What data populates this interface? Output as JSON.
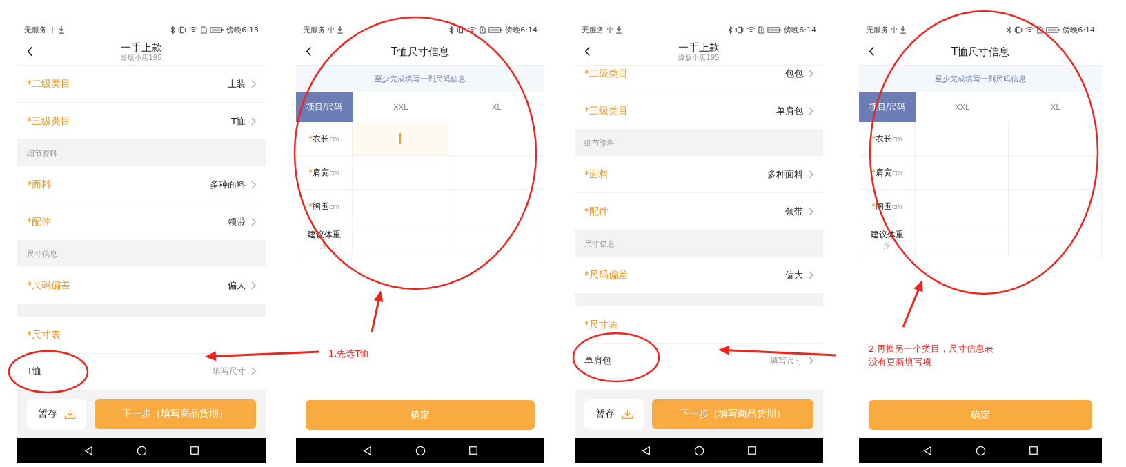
{
  "screens": [
    {
      "kind": "form",
      "scrolled": false,
      "status_bar": {
        "carrier": "无服务",
        "time": "傍晚6:13"
      },
      "header": {
        "title": "一手上款",
        "subtitle": "爆版小店195"
      },
      "items": [
        {
          "kind": "row",
          "label": "*二级类目",
          "value": "上装"
        },
        {
          "kind": "row",
          "label": "*三级类目",
          "value": "T恤"
        },
        {
          "kind": "section",
          "label": "细节资料"
        },
        {
          "kind": "row",
          "label": "*面料",
          "value": "多种面料"
        },
        {
          "kind": "row",
          "label": "*配件",
          "value": "领带"
        },
        {
          "kind": "section",
          "label": "尺寸信息"
        },
        {
          "kind": "row",
          "label": "*尺码偏差",
          "value": "偏大"
        },
        {
          "kind": "gap"
        },
        {
          "kind": "title",
          "label": "*尺寸表"
        },
        {
          "kind": "link",
          "label": "T恤",
          "value": "填写尺寸"
        }
      ],
      "footer": {
        "save": "暂存",
        "next": "下一步（填写商品货期）"
      }
    },
    {
      "kind": "size_table",
      "status_bar": {
        "carrier": "无服务",
        "time": "傍晚6:14"
      },
      "header": {
        "title": "T恤尺寸信息"
      },
      "notice": "至少完成填写一列尺码信息",
      "table": {
        "corner": "项目/尺码",
        "columns": [
          "XXL",
          "XL"
        ],
        "rows": [
          {
            "mark": "*",
            "label": "衣长",
            "unit": "cm",
            "cells": [
              {
                "focused": true
              },
              {
                "focused": false
              }
            ]
          },
          {
            "mark": "*",
            "label": "肩宽",
            "unit": "cm",
            "cells": [
              {
                "focused": false
              },
              {
                "focused": false
              }
            ]
          },
          {
            "mark": "*",
            "label": "胸围",
            "unit": "cm",
            "cells": [
              {
                "focused": false
              },
              {
                "focused": false
              }
            ]
          },
          {
            "label": "建议体重",
            "unit": "斤",
            "cells": [
              {
                "focused": false
              },
              {
                "focused": false
              }
            ]
          }
        ]
      },
      "confirm": "确定"
    },
    {
      "kind": "form",
      "scrolled": true,
      "status_bar": {
        "carrier": "无服务",
        "time": "傍晚6:14"
      },
      "header": {
        "title": "一手上款",
        "subtitle": "爆版小店195"
      },
      "items": [
        {
          "kind": "row",
          "label": "*二级类目",
          "value": "包包"
        },
        {
          "kind": "row",
          "label": "*三级类目",
          "value": "单肩包"
        },
        {
          "kind": "section",
          "label": "细节资料"
        },
        {
          "kind": "row",
          "label": "*面料",
          "value": "多种面料"
        },
        {
          "kind": "row",
          "label": "*配件",
          "value": "领带"
        },
        {
          "kind": "section",
          "label": "尺寸信息"
        },
        {
          "kind": "row",
          "label": "*尺码偏差",
          "value": "偏大"
        },
        {
          "kind": "gap"
        },
        {
          "kind": "title",
          "label": "*尺寸表"
        },
        {
          "kind": "link",
          "label": "单肩包",
          "value": "填写尺寸"
        }
      ],
      "footer": {
        "save": "暂存",
        "next": "下一步（填写商品货期）"
      }
    },
    {
      "kind": "size_table",
      "status_bar": {
        "carrier": "无服务",
        "time": "傍晚6:14"
      },
      "header": {
        "title": "T恤尺寸信息"
      },
      "notice": "至少完成填写一列尺码信息",
      "table": {
        "corner": "项目/尺码",
        "columns": [
          "XXL",
          "XL"
        ],
        "rows": [
          {
            "mark": "*",
            "label": "衣长",
            "unit": "cm",
            "cells": [
              {
                "focused": false
              },
              {
                "focused": false
              }
            ]
          },
          {
            "mark": "*",
            "label": "肩宽",
            "unit": "cm",
            "cells": [
              {
                "focused": false
              },
              {
                "focused": false
              }
            ]
          },
          {
            "mark": "*",
            "label": "胸围",
            "unit": "cm",
            "cells": [
              {
                "focused": false
              },
              {
                "focused": false
              }
            ]
          },
          {
            "label": "建议体重",
            "unit": "斤",
            "cells": [
              {
                "focused": false
              },
              {
                "focused": false
              }
            ]
          }
        ]
      },
      "confirm": "确定"
    }
  ],
  "annotations": [
    {
      "lines": [
        "1.先选T恤"
      ]
    },
    {
      "lines": [
        "2.再换另一个类目，尺寸信息表",
        "没有更新填写项"
      ]
    }
  ]
}
